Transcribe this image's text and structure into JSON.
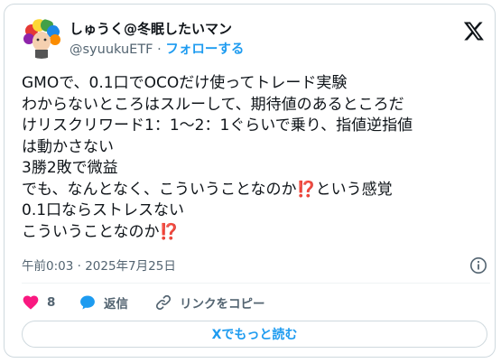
{
  "author": {
    "name": "しゅうく@冬眠したいマン",
    "handle": "@syuukuETF",
    "separator": "·",
    "follow_label": "フォローする"
  },
  "tweet": {
    "lines": [
      "GMOで、0.1口でOCOだけ使ってトレード実験",
      "わからないところはスルーして、期待値のあるところだ",
      "けリスクリワード1：1〜2：1ぐらいで乗り、指値逆指値",
      "は動かさない",
      "3勝2敗で微益"
    ],
    "line6_a": "でも、なんとなく、こういうことなのか",
    "line6_emoji": "⁉️",
    "line6_b": "という感覚",
    "line7": "0.1口ならストレスない",
    "line8_a": "こういうことなのか",
    "line8_emoji": "⁉️"
  },
  "timestamp": "午前0:03 · 2025年7月25日",
  "actions": {
    "like_count": "8",
    "reply_label": "返信",
    "copy_link_label": "リンクをコピー"
  },
  "read_more_label": "Xでもっと読む",
  "icons": {
    "logo": "x-logo-icon",
    "info": "info-icon",
    "like": "heart-icon",
    "reply": "speech-bubble-icon",
    "link": "link-icon"
  },
  "colors": {
    "accent": "#1d9bf0",
    "like": "#f91880",
    "text": "#0f1419",
    "muted": "#536471"
  }
}
